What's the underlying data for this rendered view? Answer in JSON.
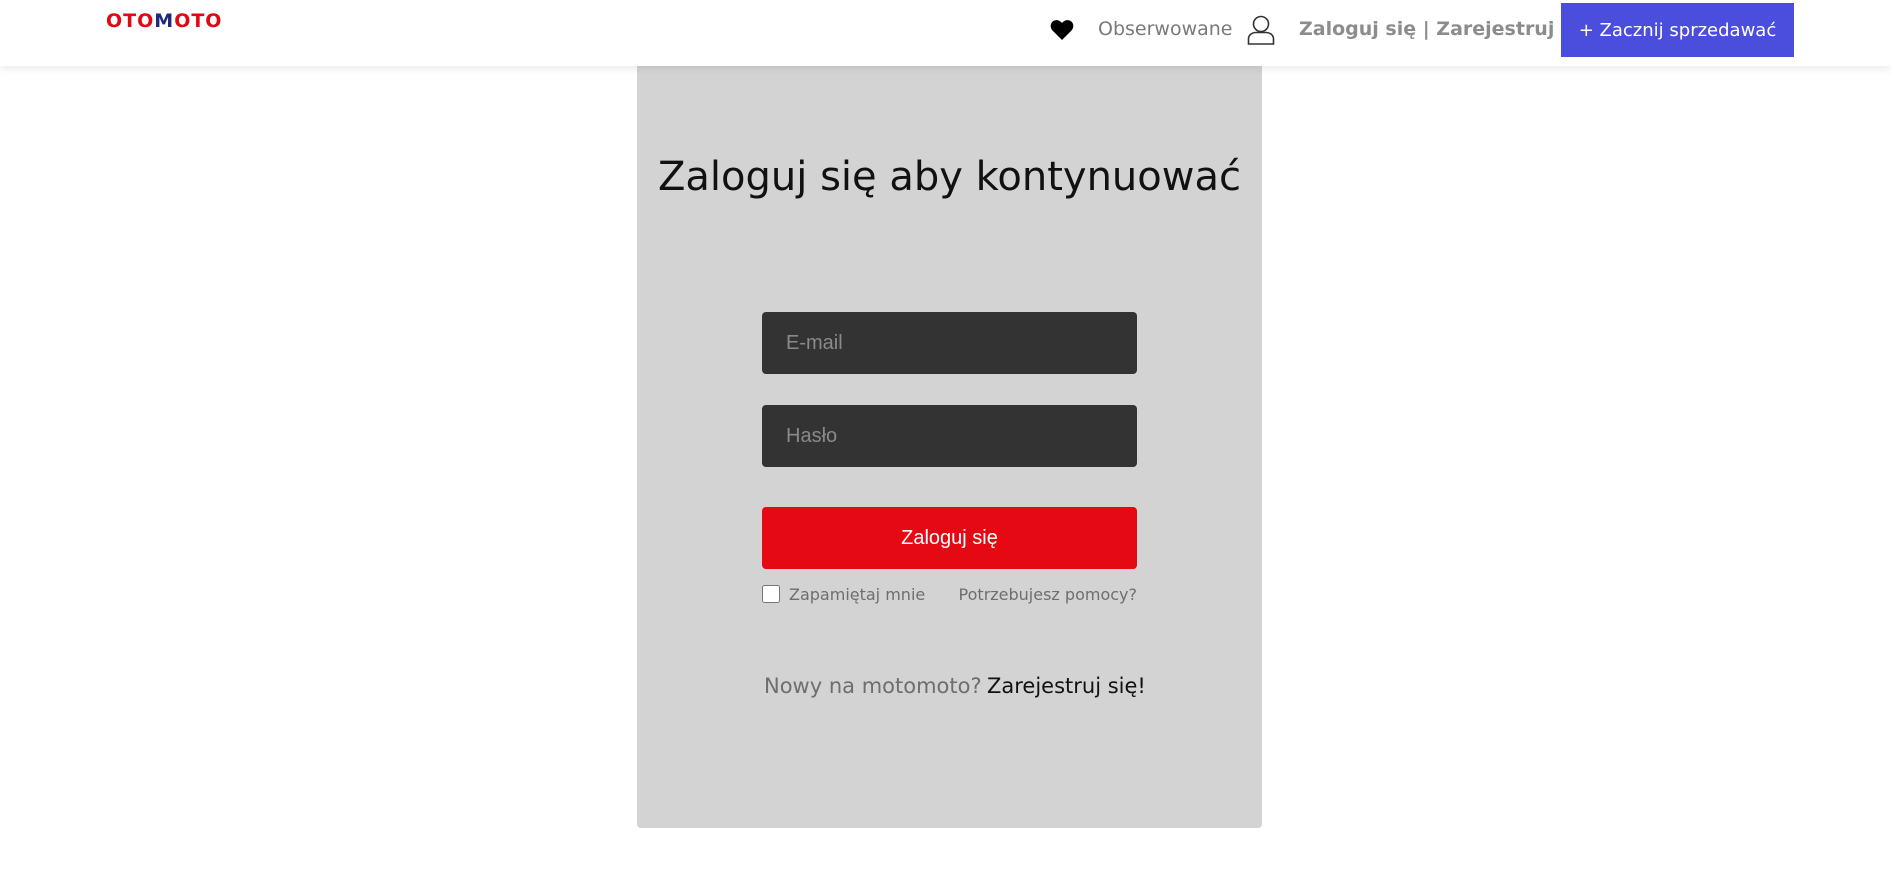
{
  "header": {
    "logo_text_a": "OTO",
    "logo_text_b": "M",
    "logo_text_c": "OTO",
    "watched_label": "Obserwowane",
    "auth_label": "Zaloguj się | Zarejestruj się",
    "sell_button_label": "+ Zacznij sprzedawać",
    "icons": [
      "heart-icon",
      "user-icon"
    ]
  },
  "login_card": {
    "title": "Zaloguj się aby kontynuować",
    "email_placeholder": "E-mail",
    "password_placeholder": "Hasło",
    "login_button_label": "Zaloguj się",
    "remember_label": "Zapamiętaj mnie",
    "help_label": "Potrzebujesz pomocy?",
    "new_user_text": "Nowy na motomoto?",
    "register_label": "Zarejestruj się!"
  },
  "colors": {
    "brand_red": "#e30613",
    "brand_navy": "#1f2a7a",
    "sell_button": "#4b4ddc",
    "login_button": "#e50914",
    "card_background": "#d3d3d3",
    "input_background": "#333333"
  }
}
